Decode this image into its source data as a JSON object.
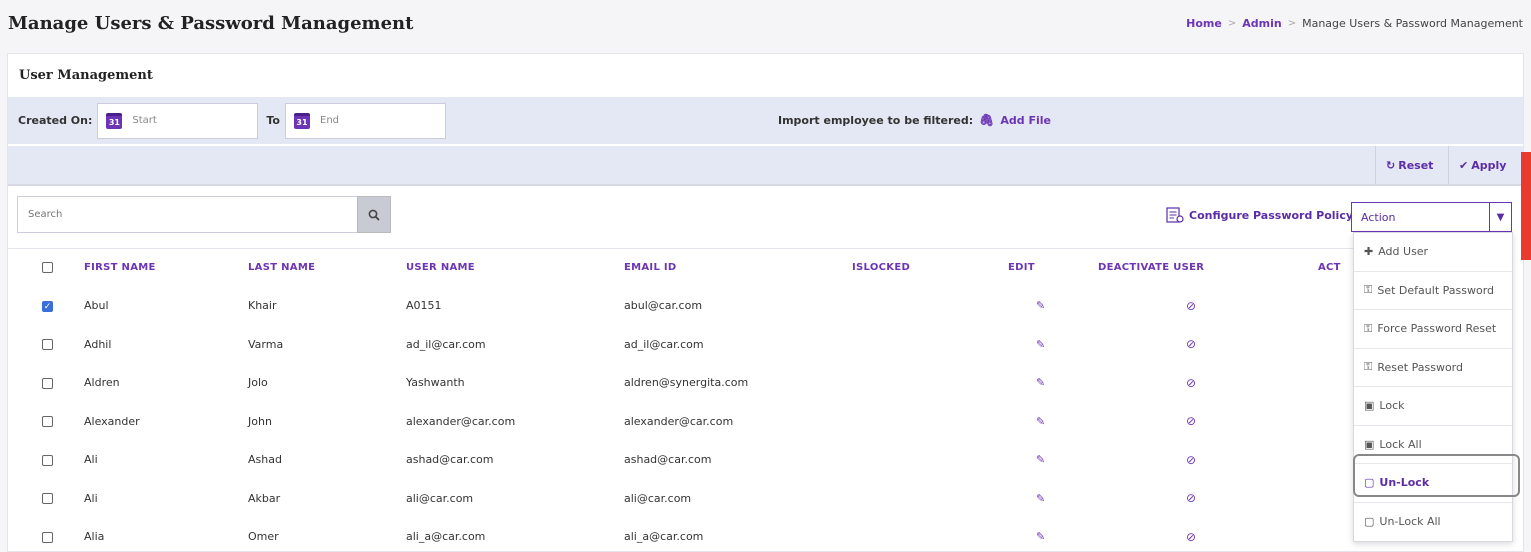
{
  "page": {
    "title": "Manage Users & Password Management"
  },
  "breadcrumb": {
    "home": "Home",
    "admin": "Admin",
    "current": "Manage Users & Password Management",
    "sep": ">"
  },
  "card": {
    "title": "User Management"
  },
  "filters": {
    "created_on_label": "Created On:",
    "start_placeholder": "Start",
    "to_label": "To",
    "end_placeholder": "End",
    "calendar_day": "31",
    "import_label": "Import employee to be filtered:",
    "add_file_label": "Add File"
  },
  "actions": {
    "reset_label": "Reset",
    "apply_label": "Apply"
  },
  "search": {
    "placeholder": "Search"
  },
  "toolbar": {
    "config_policy_label": "Configure Password Policy",
    "action_select_value": "Action"
  },
  "table": {
    "headers": [
      "FIRST NAME",
      "LAST NAME",
      "USER NAME",
      "EMAIL ID",
      "ISLOCKED",
      "EDIT",
      "DEACTIVATE USER",
      "ACT"
    ],
    "rows": [
      {
        "checked": true,
        "first": "Abul",
        "last": "Khair",
        "user": "A0151",
        "email": "abul@car.com"
      },
      {
        "checked": false,
        "first": "Adhil",
        "last": "Varma",
        "user": "ad_il@car.com",
        "email": "ad_il@car.com"
      },
      {
        "checked": false,
        "first": "Aldren",
        "last": "Jolo",
        "user": "Yashwanth",
        "email": "aldren@synergita.com"
      },
      {
        "checked": false,
        "first": "Alexander",
        "last": "John",
        "user": "alexander@car.com",
        "email": "alexander@car.com"
      },
      {
        "checked": false,
        "first": "Ali",
        "last": "Ashad",
        "user": "ashad@car.com",
        "email": "ashad@car.com"
      },
      {
        "checked": false,
        "first": "Ali",
        "last": "Akbar",
        "user": "ali@car.com",
        "email": "ali@car.com"
      },
      {
        "checked": false,
        "first": "Alia",
        "last": "Omer",
        "user": "ali_a@car.com",
        "email": "ali_a@car.com"
      }
    ]
  },
  "menu": {
    "items": [
      {
        "label": "Add User",
        "icon": "plus-icon"
      },
      {
        "label": "Set Default Password",
        "icon": "key-icon"
      },
      {
        "label": "Force Password Reset",
        "icon": "key-icon"
      },
      {
        "label": "Reset Password",
        "icon": "key-icon"
      },
      {
        "label": "Lock",
        "icon": "lock-icon"
      },
      {
        "label": "Lock All",
        "icon": "lock-icon"
      },
      {
        "label": "Un-Lock",
        "icon": "unlock-icon",
        "selected": true
      },
      {
        "label": "Un-Lock All",
        "icon": "unlock-icon"
      }
    ]
  },
  "colors": {
    "accent": "#6c35b5",
    "filter_bg": "#e4e8f4",
    "check_on": "#3a6fd8",
    "side_tab": "#e83a2e"
  }
}
